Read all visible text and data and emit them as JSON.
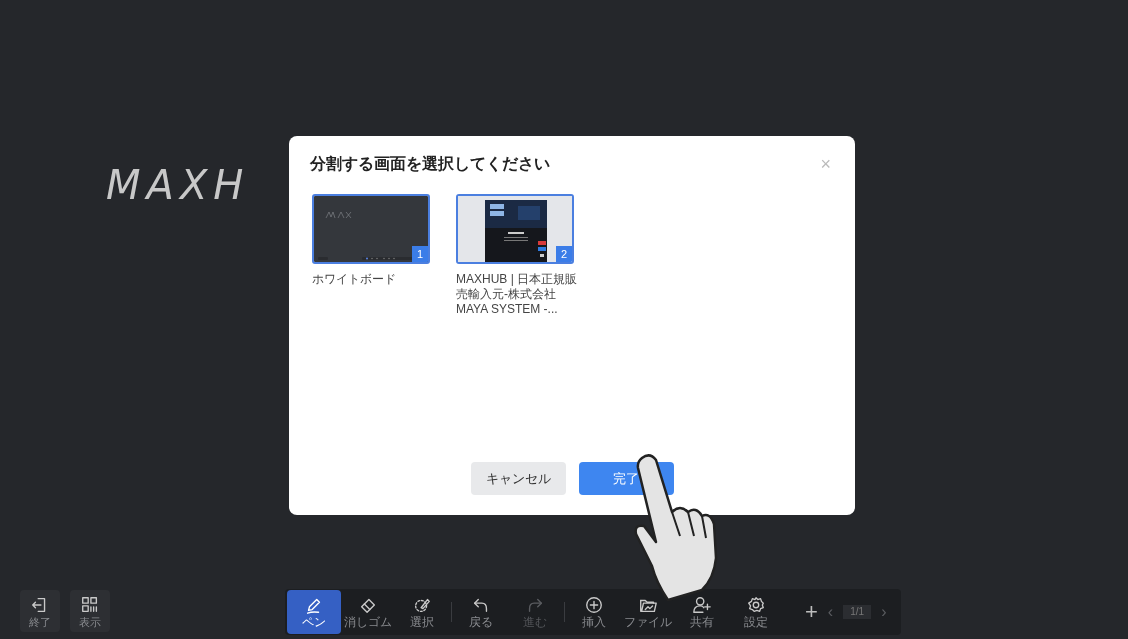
{
  "canvas": {
    "handwriting": "MAXH"
  },
  "dialog": {
    "title": "分割する画面を選択してください",
    "close": "×",
    "screens": [
      {
        "kind": "whiteboard",
        "number": "1",
        "label": "ホワイトボード",
        "selected": true
      },
      {
        "kind": "web",
        "number": "2",
        "label": "MAXHUB | 日本正規販売輸入元-株式会社MAYA SYSTEM -...",
        "selected": true
      }
    ],
    "buttons": [
      {
        "label": "キャンセル",
        "kind": "secondary"
      },
      {
        "label": "完了",
        "kind": "primary"
      }
    ]
  },
  "left_tools": [
    {
      "label": "終了"
    },
    {
      "label": "表示"
    }
  ],
  "toolbar": [
    {
      "label": "ペン",
      "selected": true,
      "disabled": false
    },
    {
      "label": "消しゴム",
      "selected": false,
      "disabled": false
    },
    {
      "label": "選択",
      "selected": false,
      "disabled": false
    },
    {
      "label": "戻る",
      "selected": false,
      "disabled": false
    },
    {
      "label": "進む",
      "selected": false,
      "disabled": true
    },
    {
      "label": "挿入",
      "selected": false,
      "disabled": false
    },
    {
      "label": "ファイル",
      "selected": false,
      "disabled": false
    },
    {
      "label": "共有",
      "selected": false,
      "disabled": false
    },
    {
      "label": "設定",
      "selected": false,
      "disabled": false
    }
  ],
  "pager": {
    "add": "+",
    "prev": "‹",
    "page": "1/1",
    "next": "›"
  }
}
